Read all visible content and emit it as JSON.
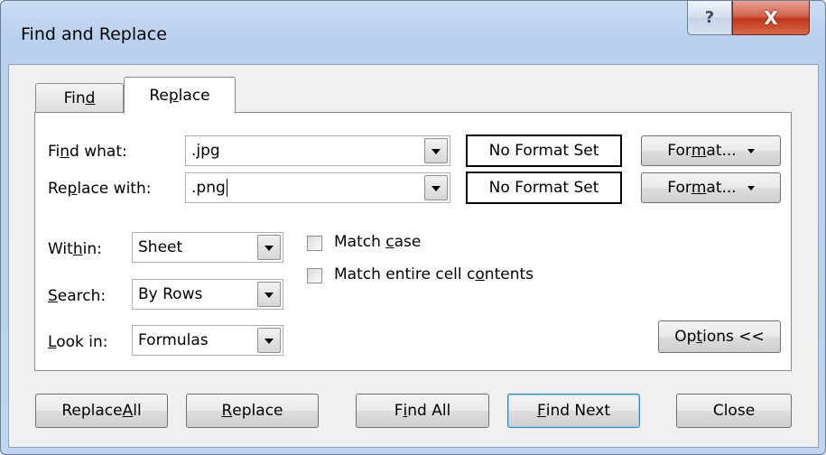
{
  "window": {
    "title": "Find and Replace",
    "help_glyph": "?",
    "close_glyph": "X"
  },
  "tabs": [
    {
      "label_pre": "Fin",
      "label_u": "d",
      "label_post": "",
      "selected": false
    },
    {
      "label_pre": "Re",
      "label_u": "p",
      "label_post": "lace",
      "selected": true
    }
  ],
  "find": {
    "label_pre": "Fi",
    "label_u": "n",
    "label_post": "d what:",
    "value": ".jpg",
    "format_status": "No Format Set",
    "format_btn_pre": "For",
    "format_btn_u": "m",
    "format_btn_post": "at..."
  },
  "replace": {
    "label_pre": "Re",
    "label_u": "p",
    "label_post": "lace with:",
    "value": ".png",
    "format_status": "No Format Set",
    "format_btn_pre": "For",
    "format_btn_u": "m",
    "format_btn_post": "at..."
  },
  "within": {
    "label_pre": "Wit",
    "label_u": "h",
    "label_post": "in:",
    "value": "Sheet"
  },
  "search": {
    "label_pre": "",
    "label_u": "S",
    "label_post": "earch:",
    "value": "By Rows"
  },
  "lookin": {
    "label_pre": "",
    "label_u": "L",
    "label_post": "ook in:",
    "value": "Formulas"
  },
  "options": {
    "match_case_pre": "Match ",
    "match_case_u": "c",
    "match_case_post": "ase",
    "match_case_checked": false,
    "match_entire_pre": "Match entire cell c",
    "match_entire_u": "o",
    "match_entire_post": "ntents",
    "match_entire_checked": false,
    "options_btn_pre": "Op",
    "options_btn_u": "t",
    "options_btn_post": "ions <<"
  },
  "buttons": {
    "replace_all_pre": "Replace ",
    "replace_all_u": "A",
    "replace_all_post": "ll",
    "replace_pre": "",
    "replace_u": "R",
    "replace_post": "eplace",
    "find_all_pre": "F",
    "find_all_u": "i",
    "find_all_post": "nd All",
    "find_next_pre": "",
    "find_next_u": "F",
    "find_next_post": "ind Next",
    "close": "Close"
  }
}
